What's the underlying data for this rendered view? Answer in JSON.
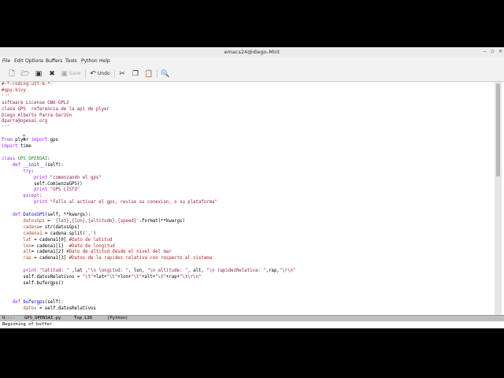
{
  "window": {
    "title": "emacs24@diego-Mint"
  },
  "menu": [
    "File",
    "Edit",
    "Options",
    "Buffers",
    "Tools",
    "Python",
    "Help"
  ],
  "toolbar": {
    "save_label": "Save",
    "undo_label": "Undo"
  },
  "code": {
    "lines": [
      [
        [
          "c-comment",
          "#-*-coding:utf-8-*-"
        ]
      ],
      [
        [
          "c-comment",
          "#qpy:kivy"
        ]
      ],
      [
        [
          "c-str",
          "'''"
        ]
      ],
      [
        [
          "c-str",
          "software License GNU-GPL3"
        ]
      ],
      [
        [
          "c-str",
          "clase GPS  referencia de la api de plyer"
        ]
      ],
      [
        [
          "c-str",
          "Diego Alberto Parra Garzón"
        ]
      ],
      [
        [
          "c-str",
          "dparra@opesai.org"
        ]
      ],
      [
        [
          "c-str",
          "'''"
        ]
      ],
      [],
      [
        [
          "c-kw",
          "from"
        ],
        [
          "",
          " plyer "
        ],
        [
          "c-kw",
          "import"
        ],
        [
          "",
          " gps"
        ]
      ],
      [
        [
          "c-kw",
          "import"
        ],
        [
          "",
          " time"
        ]
      ],
      [],
      [
        [
          "c-kw",
          "class"
        ],
        [
          "",
          " "
        ],
        [
          "c-type",
          "GPS_OPENSAI"
        ],
        [
          "",
          ":"
        ]
      ],
      [
        [
          "",
          "    "
        ],
        [
          "c-kw",
          "def"
        ],
        [
          "",
          " "
        ],
        [
          "c-fn",
          "__init__"
        ],
        [
          "",
          "(self):"
        ]
      ],
      [
        [
          "",
          "        "
        ],
        [
          "c-kw",
          "try"
        ],
        [
          "",
          ":"
        ]
      ],
      [
        [
          "",
          "            "
        ],
        [
          "c-kw",
          "print"
        ],
        [
          "",
          " "
        ],
        [
          "c-str",
          "\"comenzando el gps\""
        ]
      ],
      [
        [
          "",
          "            self.ComienzaGPS()"
        ]
      ],
      [
        [
          "",
          "            "
        ],
        [
          "c-kw",
          "print"
        ],
        [
          "",
          " "
        ],
        [
          "c-str",
          "\"GPS LISTO\""
        ]
      ],
      [
        [
          "",
          "        "
        ],
        [
          "c-kw",
          "except"
        ],
        [
          "",
          ":"
        ]
      ],
      [
        [
          "",
          "            "
        ],
        [
          "c-kw",
          "print"
        ],
        [
          "",
          " "
        ],
        [
          "c-str",
          "\"Fallo al activar el gps, revise su conexion, o su plataforma\""
        ]
      ],
      [],
      [
        [
          "",
          "    "
        ],
        [
          "c-kw",
          "def"
        ],
        [
          "",
          " "
        ],
        [
          "c-fn",
          "DatosGPS"
        ],
        [
          "",
          "(self, **kwargs):"
        ]
      ],
      [
        [
          "",
          "        "
        ],
        [
          "c-var",
          "datosGps"
        ],
        [
          "",
          " = "
        ],
        [
          "c-str",
          "'{lat},{lon},{altitude},{speed}'"
        ],
        [
          "",
          ".format(**kwargs)"
        ]
      ],
      [
        [
          "",
          "        "
        ],
        [
          "c-var",
          "cadena"
        ],
        [
          "",
          "= str(datosGps)"
        ]
      ],
      [
        [
          "",
          "        "
        ],
        [
          "c-var",
          "cadena1"
        ],
        [
          "",
          " = cadena.split("
        ],
        [
          "c-str",
          "','"
        ],
        [
          "",
          ")"
        ]
      ],
      [
        [
          "",
          "        "
        ],
        [
          "c-var",
          "lat"
        ],
        [
          "",
          " = cadena1[0] "
        ],
        [
          "c-comment",
          "#Dato de latitud"
        ]
      ],
      [
        [
          "",
          "        "
        ],
        [
          "c-var",
          "lon"
        ],
        [
          "",
          "= cadena1[1]  "
        ],
        [
          "c-comment",
          "#Dato de longitud"
        ]
      ],
      [
        [
          "",
          "        "
        ],
        [
          "c-var",
          "alt"
        ],
        [
          "",
          "= cadena1[2] "
        ],
        [
          "c-comment",
          "#Dato de altitud desde el nivel del mar"
        ]
      ],
      [
        [
          "",
          "        "
        ],
        [
          "c-var",
          "rap"
        ],
        [
          "",
          " = cadena1[3] "
        ],
        [
          "c-comment",
          "#Datos de la rapidez relativa con respecto al sistema"
        ]
      ],
      [],
      [
        [
          "",
          "        "
        ],
        [
          "c-kw",
          "print"
        ],
        [
          "",
          " "
        ],
        [
          "c-str",
          "\"latitud: \""
        ],
        [
          "",
          " ,lat ,"
        ],
        [
          "c-str",
          "\"\\n longitud: \""
        ],
        [
          "",
          ", lon, "
        ],
        [
          "c-str",
          "\"\\n altitude: \""
        ],
        [
          "",
          ", alt, "
        ],
        [
          "c-str",
          "\"\\n rapidezRelativa: \""
        ],
        [
          "",
          ",rap,"
        ],
        [
          "c-str",
          "\"\\r\\n\""
        ]
      ],
      [
        [
          "",
          "        self.datosRelativos = "
        ],
        [
          "c-str",
          "\"\\t\""
        ],
        [
          "",
          "+lat+"
        ],
        [
          "c-str",
          "\"\\t\""
        ],
        [
          "",
          "+lon+"
        ],
        [
          "c-str",
          "\"\\t\""
        ],
        [
          "",
          "+alt+"
        ],
        [
          "c-str",
          "\"\\t\""
        ],
        [
          "",
          "+rap+"
        ],
        [
          "c-str",
          "\"\\t\\r\\n\""
        ]
      ],
      [
        [
          "",
          "        self.bufergps()"
        ]
      ],
      [],
      [],
      [
        [
          "",
          "    "
        ],
        [
          "c-kw",
          "def"
        ],
        [
          "",
          " "
        ],
        [
          "c-fn",
          "bufergps"
        ],
        [
          "",
          "(self):"
        ]
      ],
      [
        [
          "",
          "        "
        ],
        [
          "c-var",
          "datos"
        ],
        [
          "",
          " = self.datosRelativos"
        ]
      ]
    ]
  },
  "modeline": {
    "status": "U:---",
    "buffer": "GPS_OPENSAI.py",
    "position": "Top L36",
    "mode": "(Python)"
  },
  "minibuffer": {
    "message": "Beginning of buffer"
  }
}
